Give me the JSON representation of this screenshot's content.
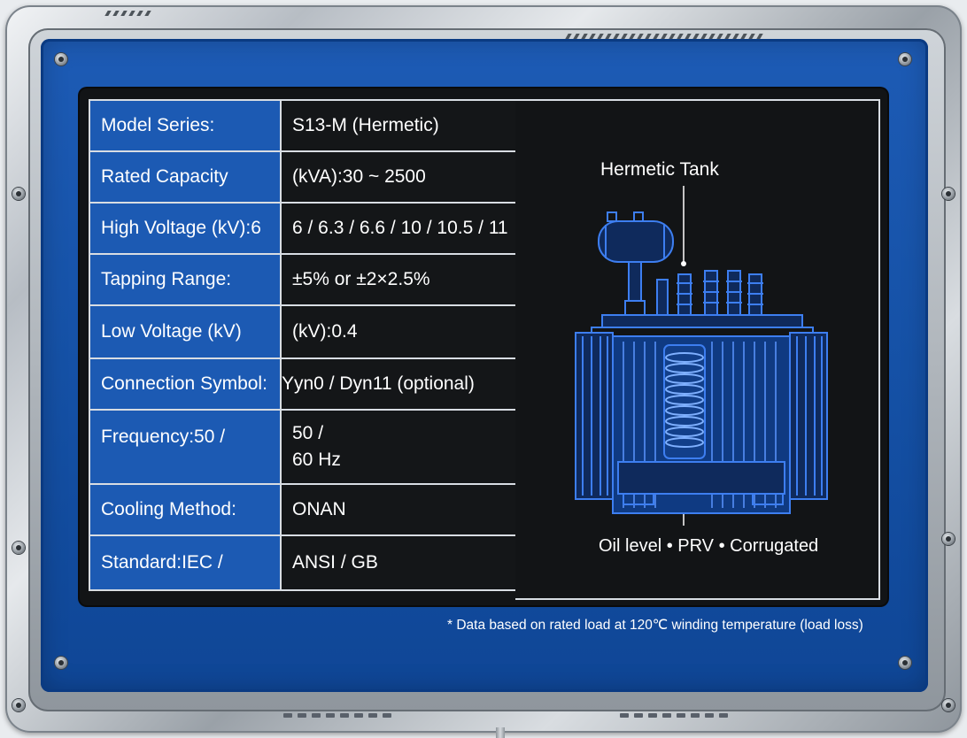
{
  "specs": [
    {
      "label": "Model Series:",
      "value": "S13-M (Hermetic)"
    },
    {
      "label": "Rated Capacity",
      "value": "(kVA):30 ~ 2500"
    },
    {
      "label": "High Voltage (kV):6",
      "value": "6 / 6.3 / 6.6 / 10 / 10.5 / 11"
    },
    {
      "label": "Tapping Range:",
      "value": "±5% or ±2×2.5%"
    },
    {
      "label": "Low Voltage (kV)",
      "value": "(kV):0.4"
    },
    {
      "label": "Connection Symbol:",
      "value": "Yyn0 / Dyn11 (optional)"
    },
    {
      "label": "Frequency:50 /",
      "value_line1": "50 /",
      "value_line2": "60 Hz"
    },
    {
      "label": "Cooling Method:",
      "value": "ONAN"
    },
    {
      "label": "Standard:IEC /",
      "value": "ANSI / GB"
    }
  ],
  "illustration": {
    "title": "Hermetic Tank",
    "caption": "Oil level • PRV • Corrugated",
    "icon": "transformer-blueprint-icon"
  },
  "footnote": "* Data based on rated load at 120℃ winding temperature (load loss)",
  "colors": {
    "panel_blue": "#1c5ab3",
    "screen_black": "#121416",
    "line_blue": "#2f6fe0"
  }
}
